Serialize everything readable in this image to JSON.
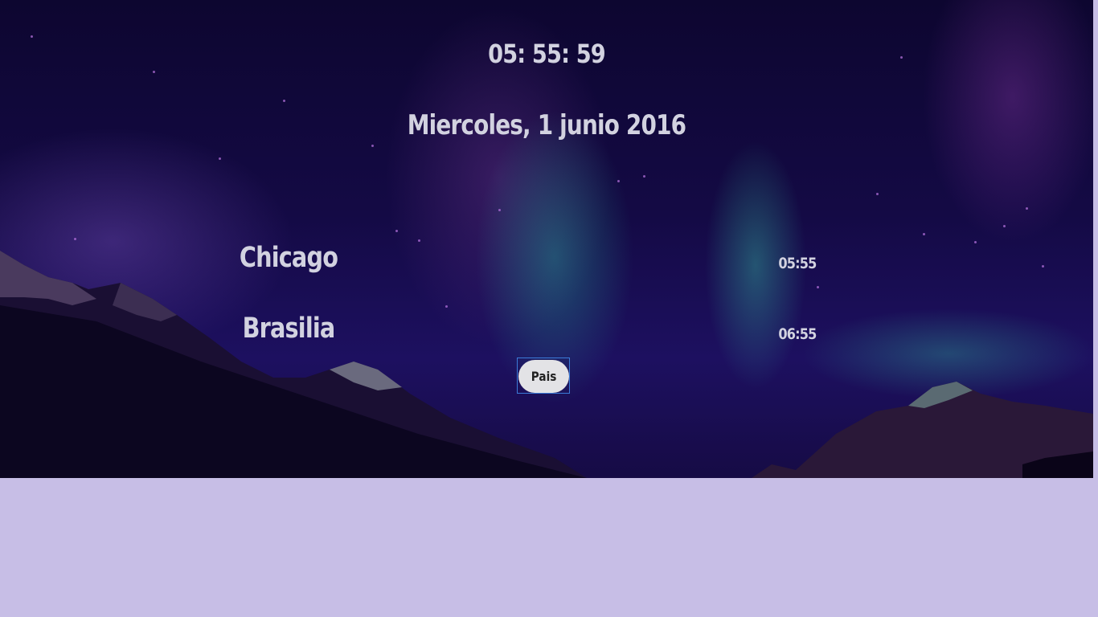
{
  "clock": {
    "time": "05: 55: 59",
    "date": "Miercoles, 1 junio 2016"
  },
  "cities": [
    {
      "name": "Chicago",
      "time": "05:55"
    },
    {
      "name": "Brasilia",
      "time": "06:55"
    }
  ],
  "button": {
    "label": "Pais"
  },
  "colors": {
    "text": "#d2d2e0",
    "page_background": "#c7bee6",
    "button_background": "#e3e3e6",
    "button_focus_border": "#3b7bd8"
  }
}
